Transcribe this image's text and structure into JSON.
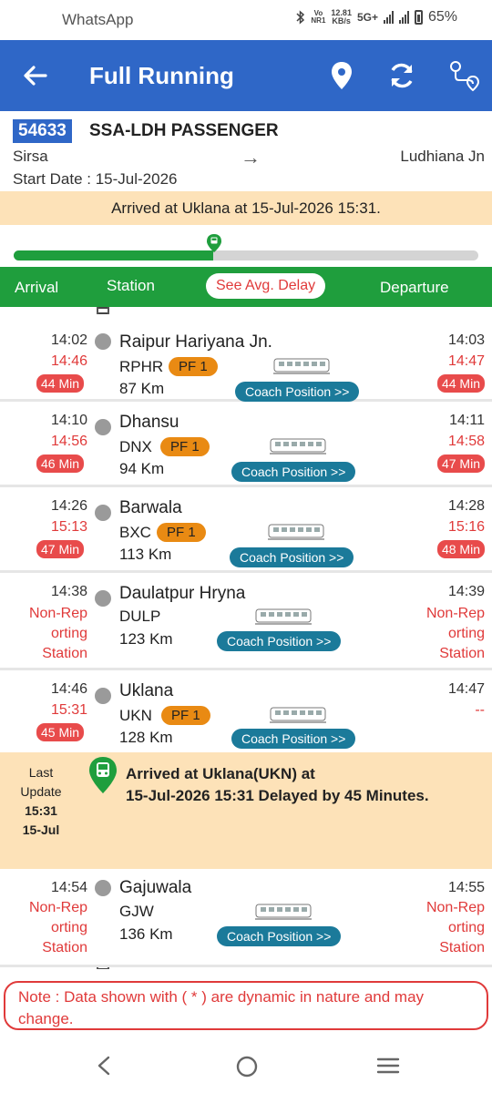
{
  "status_bar": {
    "app": "WhatsApp",
    "net_speed_value": "12.81",
    "net_speed_unit": "KB/s",
    "volte": "Vo",
    "nr": "NR1",
    "network": "5G+",
    "battery": "65%",
    "icons": [
      "bluetooth-icon",
      "signal-icon",
      "battery-icon"
    ]
  },
  "appbar": {
    "title": "Full Running",
    "icons": [
      "back-arrow-icon",
      "location-pin-icon",
      "refresh-icon",
      "route-map-icon"
    ],
    "color": "#2f67c7"
  },
  "train": {
    "number": "54633",
    "name": "SSA-LDH PASSENGER",
    "from": "Sirsa",
    "arrow": "→",
    "to": "Ludhiana Jn",
    "start_date": "Start Date : 15-Jul-2026"
  },
  "banner": "Arrived at Uklana at 15-Jul-2026 15:31.",
  "progress": {
    "fraction": 0.43
  },
  "columns": {
    "arrival": "Arrival",
    "station": "Station",
    "avg_delay": "See Avg. Delay",
    "departure": "Departure"
  },
  "stations": [
    {
      "arr_sch": "14:02",
      "arr_act": "14:46",
      "arr_delay": "44 Min",
      "name": "Raipur Hariyana Jn.",
      "code": "RPHR",
      "pf": "PF 1",
      "km": "87 Km",
      "dep_sch": "14:03",
      "dep_act": "14:47",
      "dep_delay": "44 Min",
      "coach": "Coach Position >>"
    },
    {
      "arr_sch": "14:10",
      "arr_act": "14:56",
      "arr_delay": "46 Min",
      "name": "Dhansu",
      "code": "DNX",
      "pf": "PF 1",
      "km": "94 Km",
      "dep_sch": "14:11",
      "dep_act": "14:58",
      "dep_delay": "47 Min",
      "coach": "Coach Position >>"
    },
    {
      "arr_sch": "14:26",
      "arr_act": "15:13",
      "arr_delay": "47 Min",
      "name": "Barwala",
      "code": "BXC",
      "pf": "PF 1",
      "km": "113 Km",
      "dep_sch": "14:28",
      "dep_act": "15:16",
      "dep_delay": "48 Min",
      "coach": "Coach Position >>"
    },
    {
      "arr_sch": "14:38",
      "arr_nonrep": [
        "Non-Rep",
        "orting",
        "Station"
      ],
      "name": "Daulatpur Hryna",
      "code": "DULP",
      "km": "123 Km",
      "dep_sch": "14:39",
      "dep_nonrep": [
        "Non-Rep",
        "orting",
        "Station"
      ],
      "coach": "Coach Position >>"
    },
    {
      "arr_sch": "14:46",
      "arr_act": "15:31",
      "arr_delay": "45 Min",
      "name": "Uklana",
      "code": "UKN",
      "pf": "PF 1",
      "km": "128 Km",
      "dep_sch": "14:47",
      "dep_act": "--",
      "coach": "Coach Position >>"
    },
    {
      "arr_sch": "14:54",
      "arr_nonrep": [
        "Non-Rep",
        "orting",
        "Station"
      ],
      "name": "Gajuwala",
      "code": "GJW",
      "km": "136 Km",
      "dep_sch": "14:55",
      "dep_nonrep": [
        "Non-Rep",
        "orting",
        "Station"
      ],
      "coach": "Coach Position >>"
    }
  ],
  "last_update": {
    "label1": "Last",
    "label2": "Update",
    "time": "15:31",
    "date": "15-Jul",
    "msg1": "Arrived at Uklana(UKN) at",
    "msg2": "15-Jul-2026 15:31 Delayed by 45 Minutes."
  },
  "note": "Note : Data shown with ( * ) are dynamic in nature and may change.",
  "navbar": {
    "icons": [
      "back-nav-icon",
      "home-nav-icon",
      "recents-nav-icon"
    ]
  }
}
